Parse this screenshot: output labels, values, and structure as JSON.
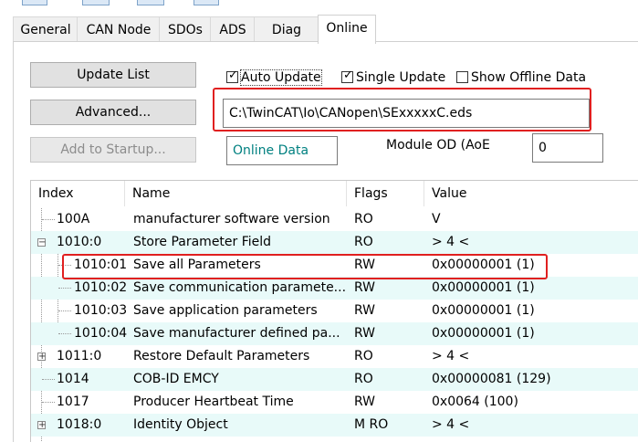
{
  "tabs": [
    "General",
    "CAN Node",
    "SDOs",
    "ADS",
    "Diag",
    "Online"
  ],
  "buttons": {
    "update_list": "Update List",
    "advanced": "Advanced...",
    "add_to_startup": "Add to Startup..."
  },
  "checks": {
    "auto_update": {
      "label": "Auto Update",
      "checked": true
    },
    "single_update": {
      "label": "Single Update",
      "checked": true
    },
    "show_offline": {
      "label": "Show Offline Data",
      "checked": false
    }
  },
  "eds_path": "C:\\TwinCAT\\Io\\CANopen\\SExxxxxC.eds",
  "online_data_label": "Online Data",
  "module_od_label": "Module OD (AoE",
  "module_od_value": "0",
  "table": {
    "headers": [
      "Index",
      "Name",
      "Flags",
      "Value"
    ],
    "rows": [
      {
        "index": "100A",
        "name": "manufacturer software version",
        "flags": "RO",
        "value": "V"
      },
      {
        "index": "1010:0",
        "name": "Store Parameter Field",
        "flags": "RO",
        "value": "> 4 <"
      },
      {
        "index": "1010:01",
        "name": "Save all Parameters",
        "flags": "RW",
        "value": "0x00000001 (1)"
      },
      {
        "index": "1010:02",
        "name": "Save communication paramete...",
        "flags": "RW",
        "value": "0x00000001 (1)"
      },
      {
        "index": "1010:03",
        "name": "Save application parameters",
        "flags": "RW",
        "value": "0x00000001 (1)"
      },
      {
        "index": "1010:04",
        "name": "Save manufacturer defined pa...",
        "flags": "RW",
        "value": "0x00000001 (1)"
      },
      {
        "index": "1011:0",
        "name": "Restore Default Parameters",
        "flags": "RO",
        "value": "> 4 <"
      },
      {
        "index": "1014",
        "name": "COB-ID EMCY",
        "flags": "RO",
        "value": "0x00000081 (129)"
      },
      {
        "index": "1017",
        "name": "Producer Heartbeat Time",
        "flags": "RW",
        "value": "0x0064 (100)"
      },
      {
        "index": "1018:0",
        "name": "Identity Object",
        "flags": "M RO",
        "value": "> 4 <"
      }
    ]
  },
  "colors": {
    "highlight": "#e02020",
    "online_data": "#008080",
    "row_alt": "#e8faf9"
  }
}
